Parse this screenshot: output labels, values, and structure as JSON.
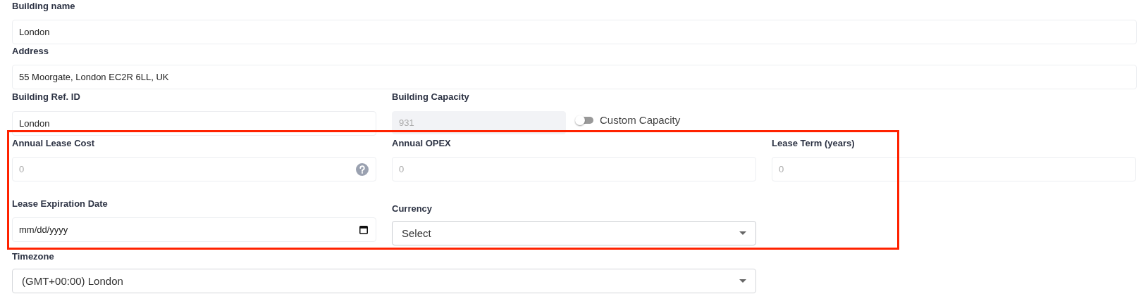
{
  "building_name": {
    "label": "Building name",
    "value": "London"
  },
  "address": {
    "label": "Address",
    "value": "55 Moorgate, London EC2R 6LL, UK"
  },
  "building_ref_id": {
    "label": "Building Ref. ID",
    "value": "London"
  },
  "building_capacity": {
    "label": "Building Capacity",
    "value": "931",
    "disabled": true
  },
  "custom_capacity": {
    "label": "Custom Capacity",
    "on": false
  },
  "annual_lease_cost": {
    "label": "Annual Lease Cost",
    "placeholder": "0"
  },
  "annual_opex": {
    "label": "Annual OPEX",
    "placeholder": "0"
  },
  "lease_term": {
    "label": "Lease Term (years)",
    "placeholder": "0"
  },
  "lease_expiration_date": {
    "label": "Lease Expiration Date",
    "placeholder": "mm/dd/yyyy"
  },
  "currency": {
    "label": "Currency",
    "placeholder": "Select"
  },
  "timezone": {
    "label": "Timezone",
    "value": "(GMT+00:00) London"
  }
}
